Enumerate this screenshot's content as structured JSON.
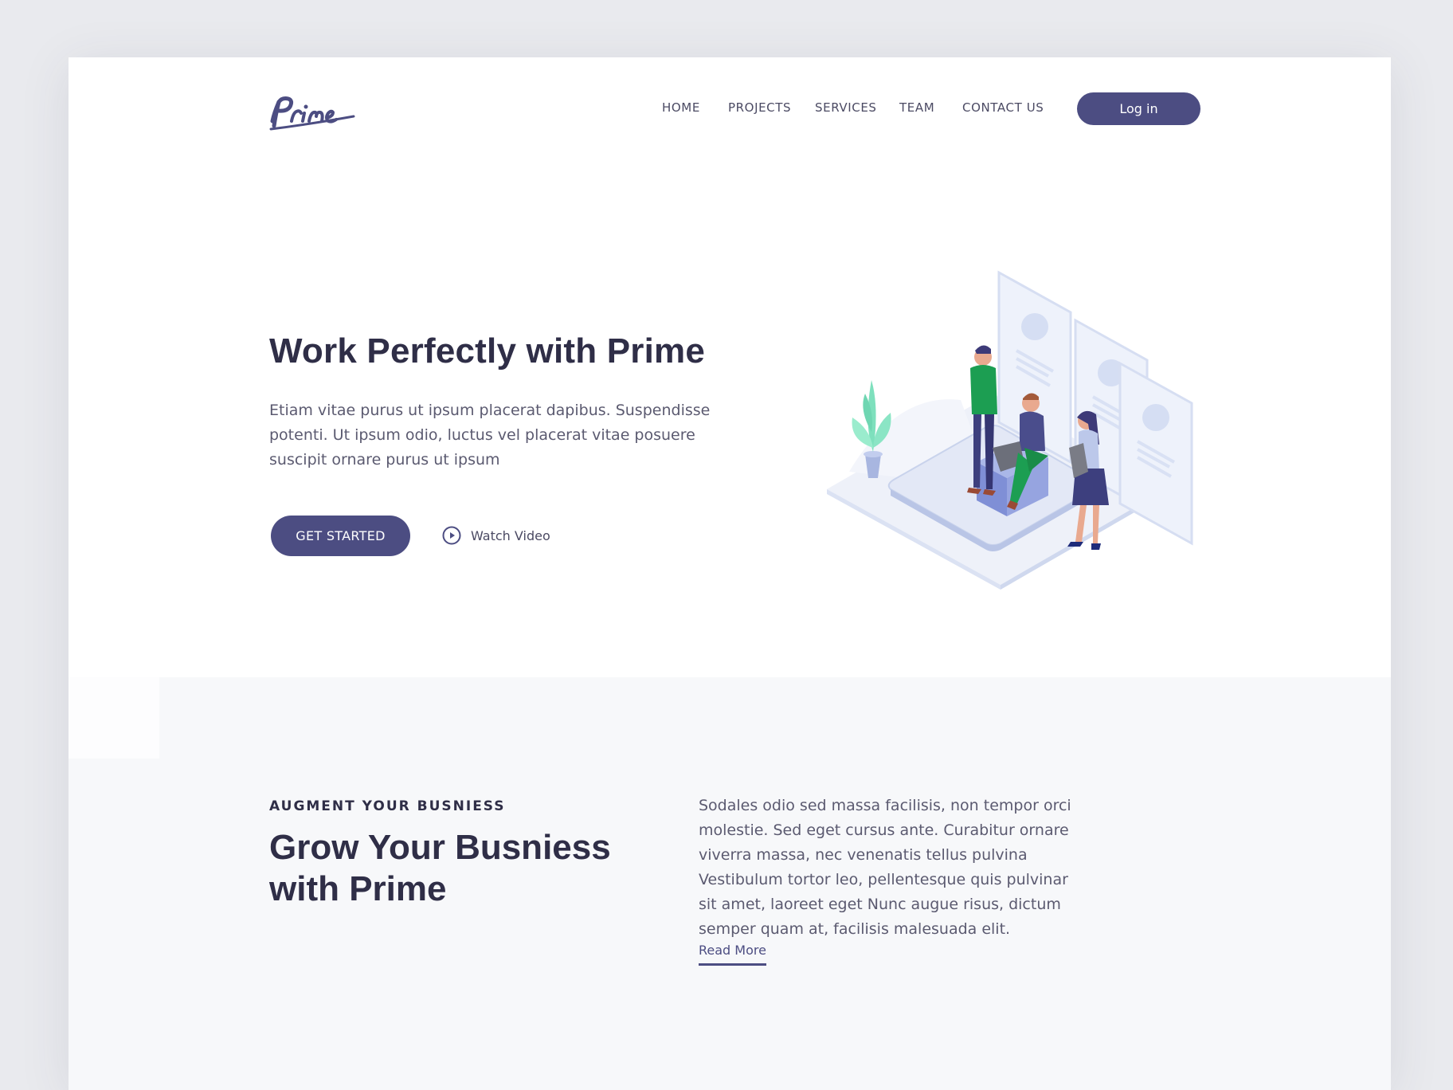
{
  "brand": {
    "logo_text": "Prime",
    "primary_color": "#4c4d82"
  },
  "nav": {
    "items": [
      {
        "label": "HOME"
      },
      {
        "label": "PROJECTS"
      },
      {
        "label": "SERVICES"
      },
      {
        "label": "TEAM"
      },
      {
        "label": "CONTACT US"
      }
    ],
    "login_label": "Log in"
  },
  "hero": {
    "title": "Work Perfectly with Prime",
    "text": "Etiam vitae purus ut ipsum placerat dapibus. Suspendisse potenti. Ut ipsum odio, luctus vel placerat vitae posuere suscipit ornare purus ut ipsum",
    "cta_label": "GET STARTED",
    "video_label": "Watch Video",
    "play_icon": "play-circle-icon",
    "illustration": "isometric-team-working-illustration"
  },
  "section": {
    "eyebrow": "AUGMENT YOUR BUSNIESS",
    "title": "Grow Your Busniess with Prime",
    "text": "Sodales odio sed massa facilisis, non tempor orci molestie. Sed eget cursus ante. Curabitur ornare viverra massa, nec venenatis tellus pulvina Vestibulum tortor leo, pellentesque quis pulvinar sit amet, laoreet eget Nunc augue risus, dictum semper quam at, facilisis malesuada elit.",
    "read_more_label": "Read More"
  }
}
